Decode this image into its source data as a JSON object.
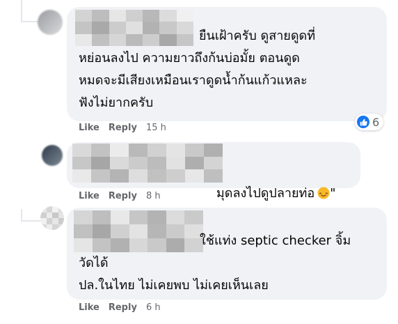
{
  "comments": [
    {
      "lines": [
        "ยืนเฝ้าครับ ดูสายดูดที่",
        "หย่อนลงไป ความยาวถึงก้นบ่อมั้ย ตอนดูด",
        "หมดจะมีเสียงเหมือนเราดูดน้ำก้นแก้วแหละ",
        "ฟังไม่ยากครับ"
      ],
      "like_label": "Like",
      "reply_label": "Reply",
      "time": "15 h",
      "reaction_count": "6"
    },
    {
      "text_before_emoji": "มุดลงไปดูปลายท่อ",
      "emoji": "smiling-face-emoji",
      "text_after_emoji": "\"",
      "like_label": "Like",
      "reply_label": "Reply",
      "time": "8 h"
    },
    {
      "lines": [
        "ใช้แท่ง septic checker จิ้ม",
        "วัดได้",
        "ปล.ในไทย ไม่เคยพบ ไม่เคยเห็นเลย"
      ],
      "like_label": "Like",
      "reply_label": "Reply",
      "time": "6 h"
    }
  ],
  "colors": {
    "bubble": "#f0f2f5",
    "meta_text": "#65676b",
    "like_blue": "#1877f2",
    "thread_line": "#e4e6eb"
  }
}
